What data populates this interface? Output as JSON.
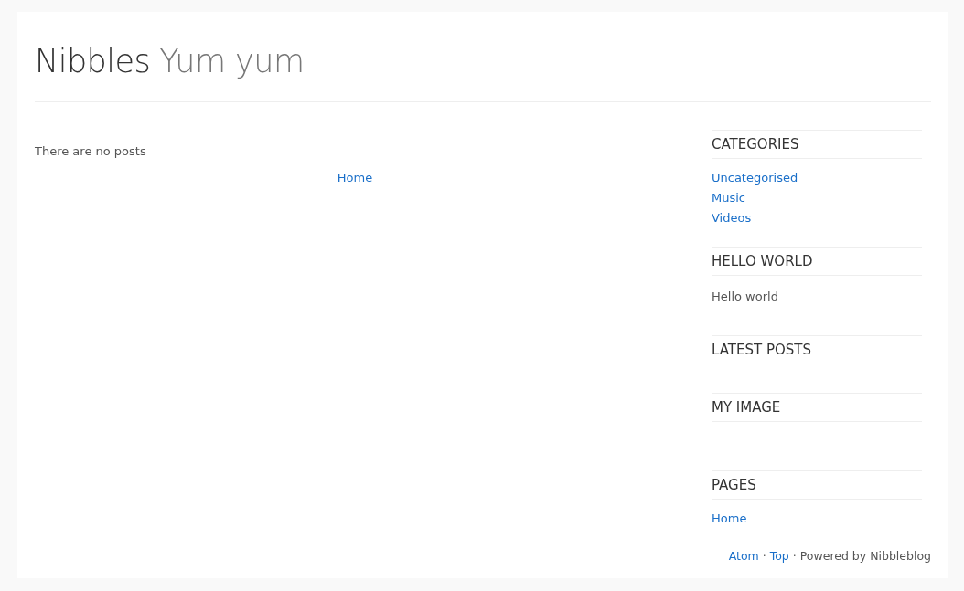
{
  "header": {
    "title": "Nibbles",
    "slogan": "Yum yum"
  },
  "main": {
    "message": "There are no posts",
    "pager": "Home"
  },
  "sidebar": [
    {
      "kind": "links",
      "title": "CATEGORIES",
      "items": [
        "Uncategorised",
        "Music",
        "Videos"
      ]
    },
    {
      "kind": "text",
      "title": "HELLO WORLD",
      "text": "Hello world"
    },
    {
      "kind": "empty",
      "title": "LATEST POSTS"
    },
    {
      "kind": "image",
      "title": "MY IMAGE"
    },
    {
      "kind": "links",
      "title": "PAGES",
      "items": [
        "Home"
      ]
    }
  ],
  "footer": [
    {
      "kind": "link",
      "text": "Atom"
    },
    {
      "kind": "text",
      "text": "·"
    },
    {
      "kind": "link",
      "text": "Top"
    },
    {
      "kind": "text",
      "text": "· Powered by Nibbleblog"
    }
  ]
}
